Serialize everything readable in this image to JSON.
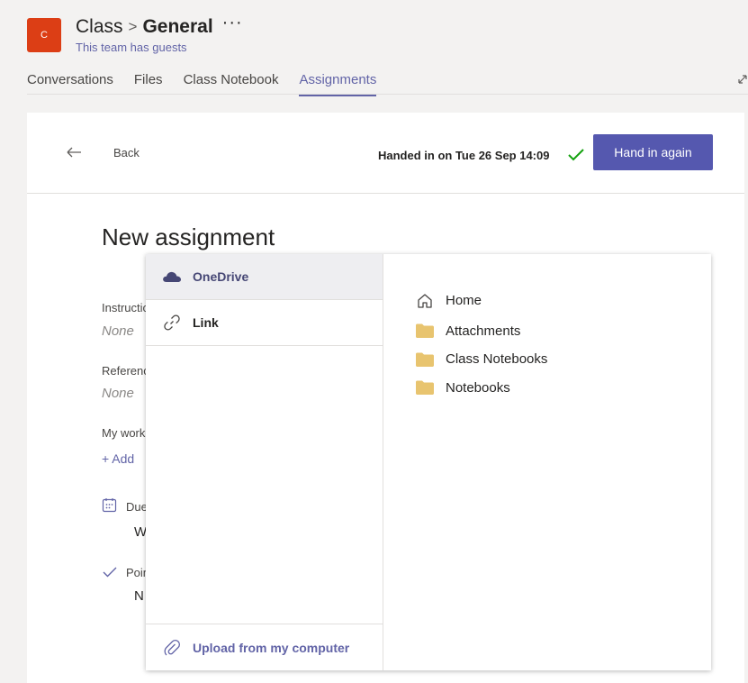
{
  "header": {
    "avatar_letter": "C",
    "team_name": "Class",
    "separator": ">",
    "channel_name": "General",
    "more": "···",
    "guests_text": "This team has guests",
    "tabs": [
      {
        "label": "Conversations"
      },
      {
        "label": "Files"
      },
      {
        "label": "Class Notebook"
      },
      {
        "label": "Assignments",
        "active": true
      }
    ]
  },
  "topbar": {
    "back_label": "Back",
    "status_text": "Handed in on Tue 26 Sep 14:09",
    "hand_in_label": "Hand in again"
  },
  "assignment": {
    "title": "New assignment",
    "instructions_label": "Instructio",
    "instructions_value": "None",
    "reference_label": "Referenc",
    "reference_value": "None",
    "my_work_label": "My work",
    "add_label": "+  Add",
    "due_label": "Due",
    "due_value": "W",
    "points_label": "Poin",
    "points_value": "N"
  },
  "picker": {
    "sources": [
      {
        "label": "OneDrive",
        "icon": "cloud-icon",
        "selected": true
      },
      {
        "label": "Link",
        "icon": "link-icon"
      }
    ],
    "upload_label": "Upload from my computer",
    "home_label": "Home",
    "folders": [
      {
        "label": "Attachments"
      },
      {
        "label": "Class Notebooks"
      },
      {
        "label": "Notebooks"
      }
    ]
  },
  "colors": {
    "accent": "#6264a7",
    "button": "#5558af",
    "avatar": "#dc3e15",
    "check": "#13a10e",
    "folder": "#e8c46f"
  }
}
